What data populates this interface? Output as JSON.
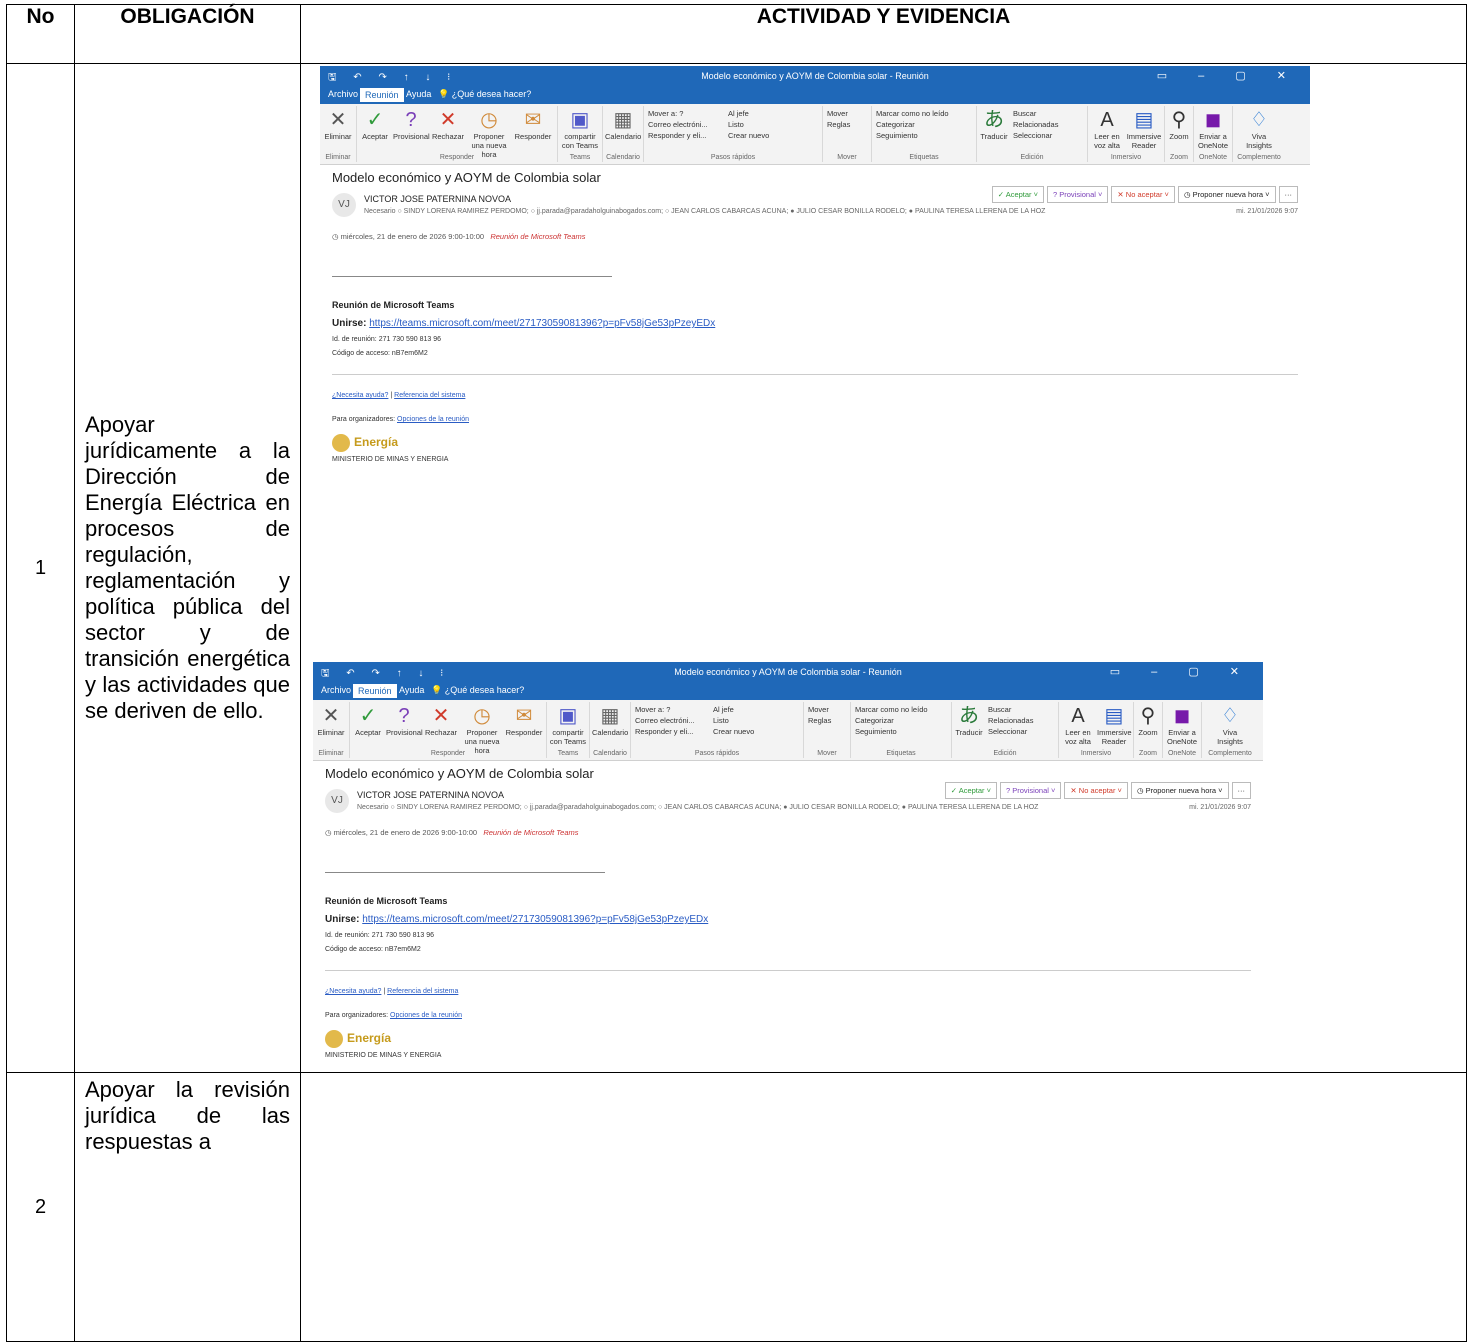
{
  "table": {
    "headers": [
      "No",
      "OBLIGACIÓN",
      "ACTIVIDAD Y EVIDENCIA"
    ],
    "rows": [
      {
        "no": "1",
        "obligation": "Apoyar jurídicamente a la Dirección de Energía Eléctrica en procesos de regulación, reglamentación y política pública del sector y de transición energética y las actividades que se deriven de ello."
      },
      {
        "no": "2",
        "obligation": "Apoyar la revisión jurídica de las respuestas a"
      }
    ]
  },
  "email": {
    "quick_access": "🖫 ↶ ↷ ↑ ↓ ⁝",
    "window_title": "Modelo económico y AOYM de Colombia solar  -  Reunión",
    "window_controls": "▭ – ▢ ✕",
    "tabs": [
      "Archivo",
      "Reunión",
      "Ayuda",
      "💡 ¿Qué desea hacer?"
    ],
    "ribbon": {
      "eliminar": "Eliminar",
      "aceptar": "Aceptar",
      "provisional": "Provisional",
      "rechazar": "Rechazar",
      "proponer": "Proponer una nueva hora",
      "responder": "Responder",
      "compartir": "compartir con Teams",
      "calendario": "Calendario",
      "quick_steps": [
        "Mover a: ?",
        "Correo electróni...",
        "Responder y eli...",
        "Al jefe",
        "Listo",
        "Crear nuevo"
      ],
      "mover": "Mover",
      "reglas": "Reglas",
      "marcar": "Marcar como no leído",
      "categorizar": "Categorizar",
      "seguimiento": "Seguimiento",
      "traducir": "Traducir",
      "buscar": "Buscar",
      "relacionadas": "Relacionadas",
      "seleccionar": "Seleccionar",
      "leer": "Leer en voz alta",
      "immersive": "Immersive Reader",
      "zoom": "Zoom",
      "onenote": "Enviar a OneNote",
      "viva": "Viva Insights",
      "groups": [
        "Eliminar",
        "Responder",
        "Teams",
        "Calendario",
        "Pasos rápidos",
        "Mover",
        "Etiquetas",
        "Edición",
        "Inmersivo",
        "Zoom",
        "OneNote",
        "Complemento"
      ]
    },
    "subject": "Modelo económico y AOYM de Colombia solar",
    "avatar": "VJ",
    "sender": "VICTOR JOSE PATERNINA NOVOA",
    "recipients": "Necesario  ○ SINDY LORENA RAMIREZ PERDOMO; ○ jj.parada@paradaholguinabogados.com; ○ JEAN CARLOS CABARCAS ACUNA; ● JULIO CESAR BONILLA RODELO; ● PAULINA TERESA LLERENA DE LA HOZ",
    "responses": [
      "✓ Aceptar ˅",
      "? Provisional ˅",
      "✕ No aceptar ˅",
      "◷ Proponer nueva hora ˅",
      "···"
    ],
    "sent_date": "mi. 21/01/2026 9:07",
    "when": "◷  miércoles, 21 de enero de 2026 9:00-10:00",
    "teams_location": "Reunión de Microsoft Teams",
    "body_heading": "Reunión de Microsoft Teams",
    "join_label": "Unirse:",
    "join_link": "https://teams.microsoft.com/meet/27173059081396?p=pFv58jGe53pPzeyEDx",
    "meeting_id": "Id. de reunión: 271 730 590 813 96",
    "access_code": "Código de acceso: nB7em6M2",
    "help_link": "¿Necesita ayuda?",
    "help_sep": "|",
    "system_ref": "Referencia del sistema",
    "organizers_label": "Para organizadores:",
    "meeting_options": "Opciones de la reunión",
    "logo_text": "Energía",
    "ministry": "MINISTERIO DE MINAS Y ENERGIA"
  }
}
